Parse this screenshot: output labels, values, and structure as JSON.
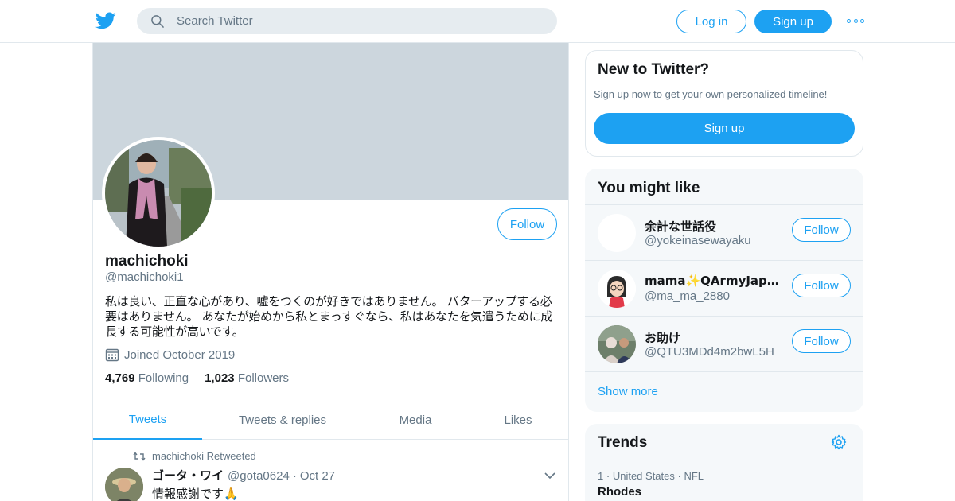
{
  "topbar": {
    "logo_icon": "twitter-bird-icon",
    "search_placeholder": "Search Twitter",
    "login_label": "Log in",
    "signup_label": "Sign up",
    "more_icon": "more-dots-icon",
    "accent": "#1da1f2"
  },
  "profile": {
    "name": "machichoki",
    "handle": "@machichoki1",
    "follow_label": "Follow",
    "bio": "私は良い、正直な心があり、嘘をつくのが好きではありません。 バターアップする必要はありません。 あなたが始めから私とまっすぐなら、私はあなたを気遣うために成長する可能性が高いです。",
    "joined": "Joined October 2019",
    "following_count": "4,769",
    "following_label": "Following",
    "followers_count": "1,023",
    "followers_label": "Followers"
  },
  "tabs": [
    {
      "label": "Tweets",
      "active": true
    },
    {
      "label": "Tweets & replies",
      "active": false
    },
    {
      "label": "Media",
      "active": false
    },
    {
      "label": "Likes",
      "active": false
    }
  ],
  "tweet": {
    "retweet_label": "machichoki Retweeted",
    "author_name": "ゴータ・ワイ",
    "author_handle": "@gota0624",
    "separator": "·",
    "date": "Oct 27",
    "text": "情報感謝です🙏"
  },
  "new_to_twitter": {
    "title": "New to Twitter?",
    "subtitle": "Sign up now to get your own personalized timeline!",
    "signup_label": "Sign up"
  },
  "you_might_like": {
    "title": "You might like",
    "users": [
      {
        "name": "余計な世話役",
        "handle": "@yokeinasewayaku",
        "follow_label": "Follow"
      },
      {
        "name": "mama✨QArmyJapanFlowers🌸",
        "handle": "@ma_ma_2880",
        "follow_label": "Follow"
      },
      {
        "name": "お助け",
        "handle": "@QTU3MDd4m2bwL5H",
        "follow_label": "Follow"
      }
    ],
    "show_more": "Show more"
  },
  "trends": {
    "title": "Trends",
    "items": [
      {
        "rank": "1",
        "sep": "·",
        "location": "United States",
        "sep2": "·",
        "category": "NFL",
        "name": "Rhodes"
      }
    ]
  }
}
